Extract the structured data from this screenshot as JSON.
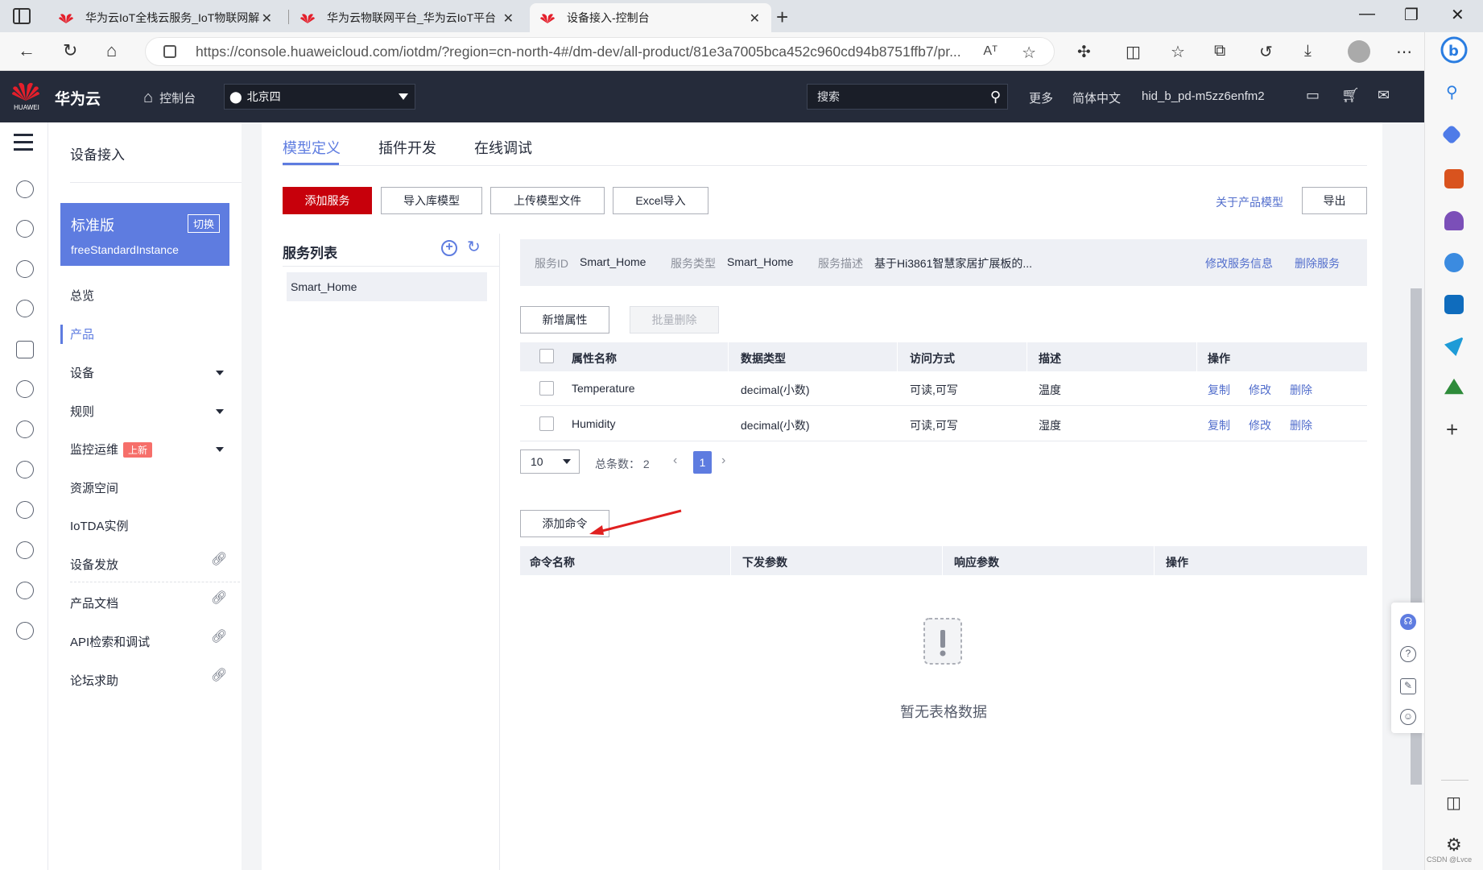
{
  "browser": {
    "tabs": [
      {
        "title": "华为云IoT全栈云服务_IoT物联网解",
        "active": false
      },
      {
        "title": "华为云物联网平台_华为云IoT平台",
        "active": false
      },
      {
        "title": "设备接入-控制台",
        "active": true
      }
    ],
    "url": "https://console.huaweicloud.com/iotdm/?region=cn-north-4#/dm-dev/all-product/81e3a7005bca452c960cd94b8751ffb7/pr...",
    "read_aloud": "Aᵀ"
  },
  "header": {
    "brand": "华为云",
    "logo_text": "HUAWEI",
    "console": "控制台",
    "region": "北京四",
    "search_placeholder": "搜索",
    "more": "更多",
    "language": "简体中文",
    "user": "hid_b_pd-m5zz6enfm2"
  },
  "sidebar": {
    "title": "设备接入",
    "edition": "标准版",
    "switch": "切换",
    "instance": "freeStandardInstance",
    "items": [
      {
        "label": "总览"
      },
      {
        "label": "产品",
        "active": true
      },
      {
        "label": "设备",
        "expandable": true
      },
      {
        "label": "规则",
        "expandable": true
      },
      {
        "label": "监控运维",
        "expandable": true,
        "badge": "上新"
      },
      {
        "label": "资源空间"
      },
      {
        "label": "IoTDA实例"
      },
      {
        "label": "设备发放",
        "external": true
      },
      {
        "label": "产品文档",
        "external": true
      },
      {
        "label": "API检索和调试",
        "external": true
      },
      {
        "label": "论坛求助",
        "external": true
      }
    ]
  },
  "content_tabs": [
    "模型定义",
    "插件开发",
    "在线调试"
  ],
  "toolbar": {
    "add_service": "添加服务",
    "import_model": "导入库模型",
    "upload_model": "上传模型文件",
    "excel_import": "Excel导入",
    "about_model": "关于产品模型",
    "export": "导出"
  },
  "service_list": {
    "title": "服务列表",
    "items": [
      "Smart_Home"
    ]
  },
  "service_info": {
    "id_label": "服务ID",
    "id": "Smart_Home",
    "type_label": "服务类型",
    "type": "Smart_Home",
    "desc_label": "服务描述",
    "desc": "基于Hi3861智慧家居扩展板的...",
    "edit": "修改服务信息",
    "delete": "删除服务"
  },
  "properties": {
    "add": "新增属性",
    "batch_delete": "批量删除",
    "headers": [
      "属性名称",
      "数据类型",
      "访问方式",
      "描述",
      "操作"
    ],
    "rows": [
      {
        "name": "Temperature",
        "type": "decimal(小数)",
        "access": "可读,可写",
        "desc": "温度"
      },
      {
        "name": "Humidity",
        "type": "decimal(小数)",
        "access": "可读,可写",
        "desc": "湿度"
      }
    ],
    "ops": [
      "复制",
      "修改",
      "删除"
    ]
  },
  "pager": {
    "page_size": "10",
    "total_label": "总条数：",
    "total": "2",
    "current": "1"
  },
  "commands": {
    "add": "添加命令",
    "headers": [
      "命令名称",
      "下发参数",
      "响应参数",
      "操作"
    ],
    "empty": "暂无表格数据"
  },
  "watermark": "CSDN @Lvce",
  "colors": {
    "accent": "#5e7ce0",
    "primary_button": "#c7000b",
    "link": "#526ecc",
    "header_bg": "#252b3a",
    "annotation": "#e02020"
  }
}
